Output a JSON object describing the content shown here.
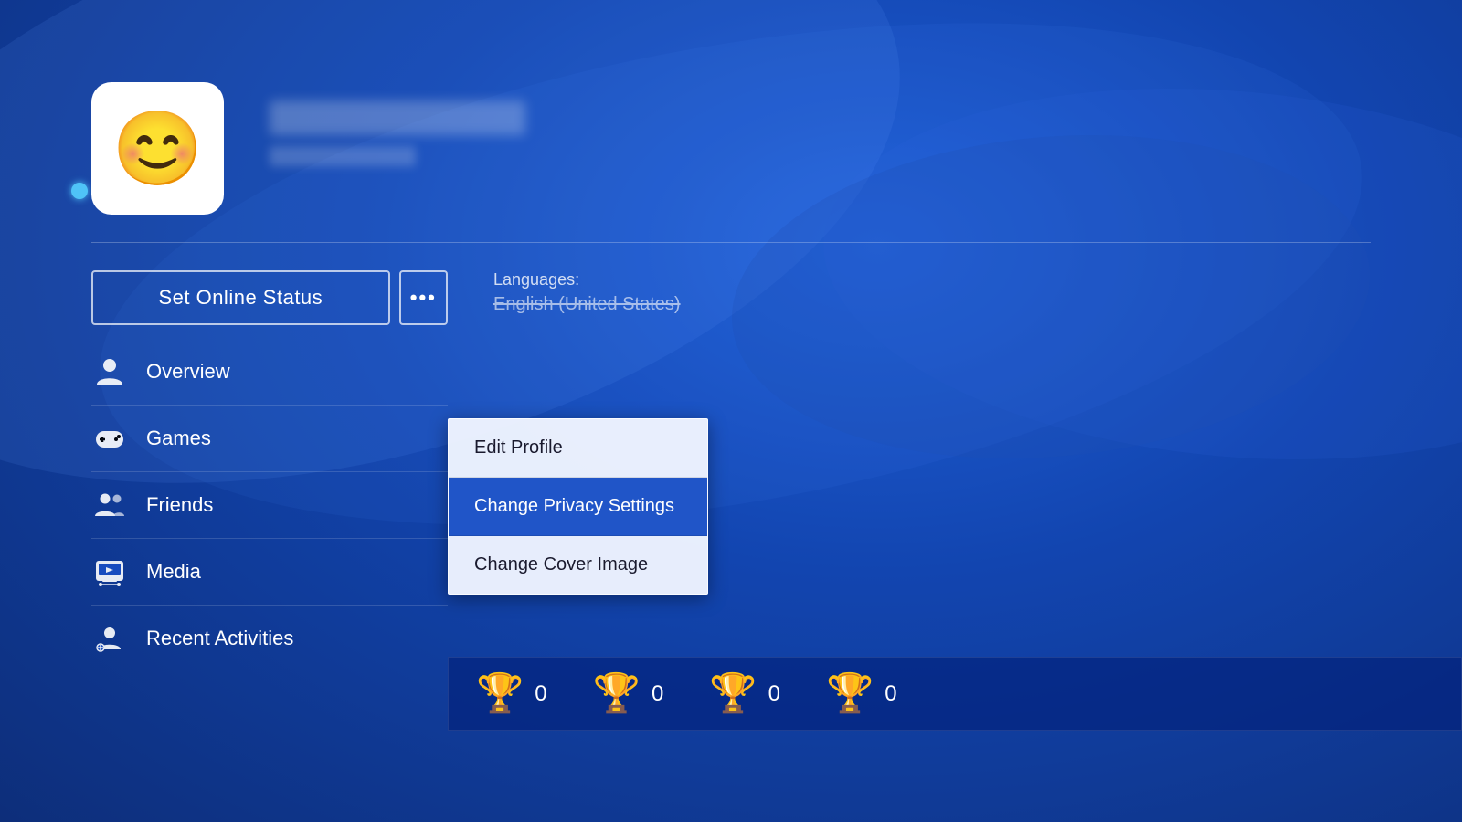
{
  "background": {
    "base_color": "#1a4fc4"
  },
  "profile": {
    "online_status": "online",
    "username_placeholder": "Username (blurred)",
    "sub_info_placeholder": "Sub info (blurred)"
  },
  "header_buttons": {
    "set_status_label": "Set Online Status",
    "more_options_label": "•••"
  },
  "nav": {
    "items": [
      {
        "id": "overview",
        "label": "Overview",
        "icon": "person-icon"
      },
      {
        "id": "games",
        "label": "Games",
        "icon": "gamepad-icon"
      },
      {
        "id": "friends",
        "label": "Friends",
        "icon": "friends-icon"
      },
      {
        "id": "media",
        "label": "Media",
        "icon": "media-icon"
      },
      {
        "id": "recent-activities",
        "label": "Recent Activities",
        "icon": "activities-icon"
      }
    ]
  },
  "profile_info": {
    "languages_label": "Languages:",
    "languages_value": "English (United States)"
  },
  "trophies": {
    "platinum": {
      "count": "0",
      "color": "#b0c4de"
    },
    "gold": {
      "count": "0",
      "color": "#ffd700"
    },
    "silver": {
      "count": "0",
      "color": "#c0c0c0"
    },
    "bronze": {
      "count": "0",
      "color": "#cd7f32"
    }
  },
  "dropdown": {
    "items": [
      {
        "id": "edit-profile",
        "label": "Edit Profile",
        "active": false
      },
      {
        "id": "change-privacy-settings",
        "label": "Change Privacy Settings",
        "active": true
      },
      {
        "id": "change-cover-image",
        "label": "Change Cover Image",
        "active": false
      }
    ]
  }
}
